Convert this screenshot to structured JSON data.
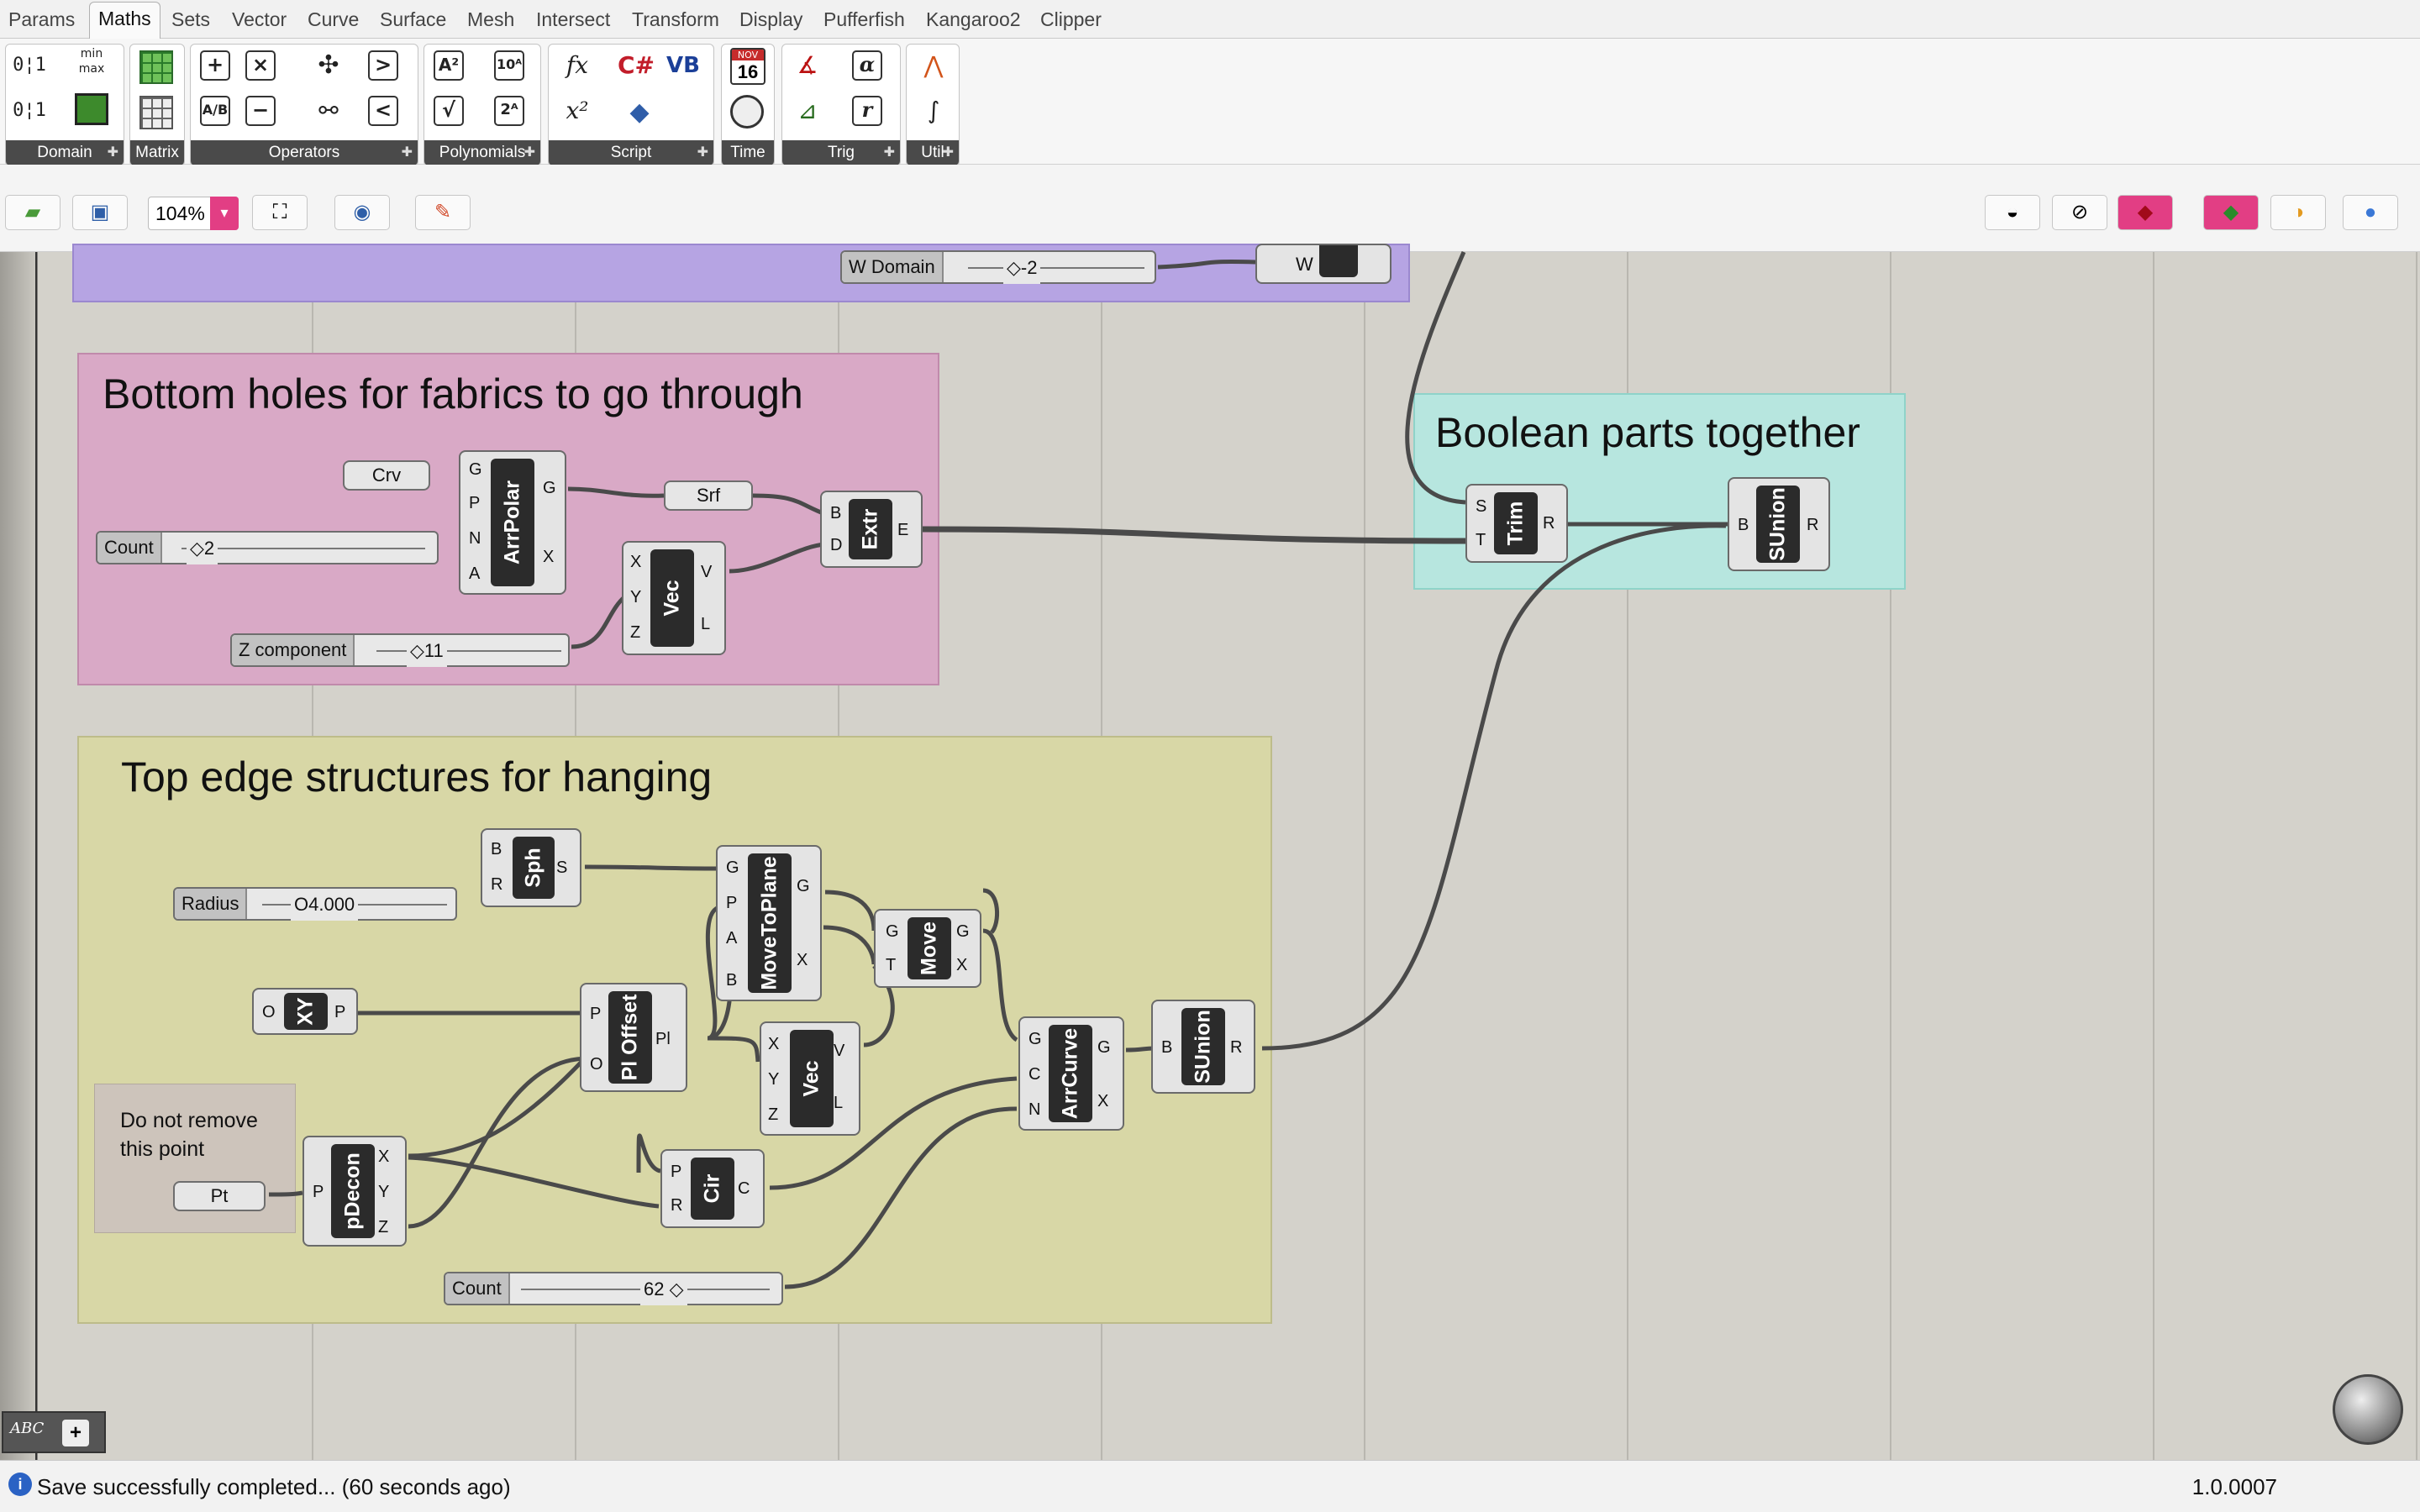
{
  "menu": {
    "tabs": [
      "Params",
      "Maths",
      "Sets",
      "Vector",
      "Curve",
      "Surface",
      "Mesh",
      "Intersect",
      "Transform",
      "Display",
      "Pufferfish",
      "Kangaroo2",
      "Clipper"
    ],
    "active": "Maths"
  },
  "ribbon": {
    "groups": [
      "Domain",
      "Matrix",
      "Operators",
      "Polynomials",
      "Script",
      "Time",
      "Trig",
      "Util"
    ],
    "icons": {
      "plus": "+",
      "times": "×",
      "divide": "A/B",
      "minus": "−",
      "greater": ">",
      "less": "<",
      "power": "A²",
      "sqrt": "√",
      "ten_pow": "10ᴬ",
      "two_pow": "2ᴬ",
      "fx": "fx",
      "x2": "x²",
      "csharp": "C#",
      "vb": "VB",
      "calendar_month": "NOV",
      "calendar_day": "16",
      "alpha": "α",
      "r": "r",
      "minmax": "min max"
    }
  },
  "toolbar": {
    "zoom": "104%"
  },
  "groups": {
    "bottom": {
      "title": "Bottom holes for fabrics to go through"
    },
    "top": {
      "title": "Top edge structures for hanging"
    },
    "boolean": {
      "title": "Boolean parts together"
    },
    "note": {
      "text_line1": "Do not remove",
      "text_line2": "this point"
    }
  },
  "components": {
    "arrpolar": {
      "name": "ArrPolar",
      "in": [
        "G",
        "P",
        "N",
        "A"
      ],
      "out": [
        "G",
        "X"
      ]
    },
    "vec1": {
      "name": "Vec",
      "in": [
        "X",
        "Y",
        "Z"
      ],
      "out": [
        "V",
        "L"
      ]
    },
    "extr": {
      "name": "Extr",
      "in": [
        "B",
        "D"
      ],
      "out": [
        "E"
      ]
    },
    "trim": {
      "name": "Trim",
      "in": [
        "S",
        "T"
      ],
      "out": [
        "R"
      ]
    },
    "sunion1": {
      "name": "SUnion",
      "in": [
        "B"
      ],
      "out": [
        "R"
      ]
    },
    "sph": {
      "name": "Sph",
      "in": [
        "B",
        "R"
      ],
      "out": [
        "S"
      ]
    },
    "movetoplane": {
      "name": "MoveToPlane",
      "in": [
        "G",
        "P",
        "A",
        "B"
      ],
      "out": [
        "G",
        "X"
      ]
    },
    "move": {
      "name": "Move",
      "in": [
        "G",
        "T"
      ],
      "out": [
        "G",
        "X"
      ]
    },
    "xy": {
      "name": "XY",
      "in": [
        "O"
      ],
      "out": [
        "P"
      ]
    },
    "ploffset": {
      "name": "Pl Offset",
      "in": [
        "P",
        "O"
      ],
      "out": [
        "Pl"
      ]
    },
    "vec2": {
      "name": "Vec",
      "in": [
        "X",
        "Y",
        "Z"
      ],
      "out": [
        "V",
        "L"
      ]
    },
    "arrcurve": {
      "name": "ArrCurve",
      "in": [
        "G",
        "C",
        "N"
      ],
      "out": [
        "G",
        "X"
      ]
    },
    "sunion2": {
      "name": "SUnion",
      "in": [
        "B"
      ],
      "out": [
        "R"
      ]
    },
    "pdecon": {
      "name": "pDecon",
      "in": [
        "P"
      ],
      "out": [
        "X",
        "Y",
        "Z"
      ]
    },
    "cir": {
      "name": "Cir",
      "in": [
        "P",
        "R"
      ],
      "out": [
        "C"
      ]
    },
    "w": {
      "name": "W"
    }
  },
  "params": {
    "crv": "Crv",
    "srf": "Srf",
    "pt": "Pt"
  },
  "sliders": {
    "wdomain": {
      "label": "W Domain",
      "value": "◇-2"
    },
    "count1": {
      "label": "Count",
      "value": "◇2"
    },
    "zcomp": {
      "label": "Z component",
      "value": "◇11"
    },
    "radius": {
      "label": "Radius",
      "value": "O4.000"
    },
    "count2": {
      "label": "Count",
      "value": "62 ◇"
    }
  },
  "status": {
    "text": "Save successfully completed... (60 seconds ago)",
    "version": "1.0.0007"
  },
  "colors": {
    "bottom_group": "#d9a9c6",
    "top_group": "#d8d7a6",
    "boolean_group": "#b7e6df",
    "purple_group": "#b6a4e3",
    "accent_pink": "#e23e84"
  }
}
